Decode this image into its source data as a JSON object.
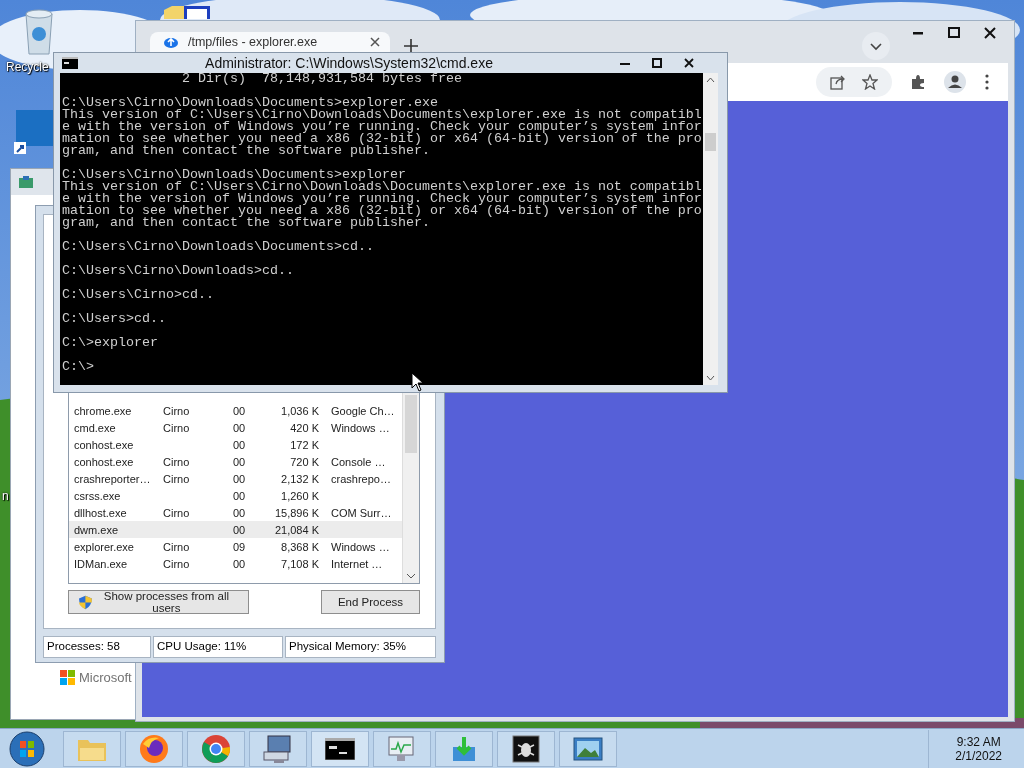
{
  "desktop": {
    "icon_labels": [
      "Recycle",
      "n"
    ]
  },
  "browser": {
    "tabs": [
      {
        "title": "/tmp/files - explorer.exe",
        "selected": true
      }
    ]
  },
  "background_window": {
    "brand": "Microsoft"
  },
  "task_manager": {
    "rows": [
      {
        "column_1": "chrome.exe",
        "column_2": "Cirno",
        "column_3": "00",
        "column_4": "1,036 K",
        "column_5": "Google Ch…",
        "selected": false
      },
      {
        "column_1": "cmd.exe",
        "column_2": "Cirno",
        "column_3": "00",
        "column_4": "420 K",
        "column_5": "Windows …",
        "selected": false
      },
      {
        "column_1": "conhost.exe",
        "column_3": "00",
        "column_4": "172 K",
        "selected": false
      },
      {
        "column_1": "conhost.exe",
        "column_2": "Cirno",
        "column_3": "00",
        "column_4": "720 K",
        "column_5": "Console …",
        "selected": false
      },
      {
        "column_1": "crashreporter…",
        "column_2": "Cirno",
        "column_3": "00",
        "column_4": "2,132 K",
        "column_5": "crashrepo…",
        "selected": false
      },
      {
        "column_1": "csrss.exe",
        "column_3": "00",
        "column_4": "1,260 K",
        "selected": false
      },
      {
        "column_1": "dllhost.exe",
        "column_2": "Cirno",
        "column_3": "00",
        "column_4": "15,896 K",
        "column_5": "COM Surr…",
        "selected": false
      },
      {
        "column_1": "dwm.exe",
        "column_3": "00",
        "column_4": "21,084 K",
        "selected": true
      },
      {
        "column_1": "explorer.exe",
        "column_2": "Cirno",
        "column_3": "09",
        "column_4": "8,368 K",
        "column_5": "Windows …",
        "selected": false
      },
      {
        "column_1": "IDMan.exe",
        "column_2": "Cirno",
        "column_3": "00",
        "column_4": "7,108 K",
        "column_5": "Internet …",
        "selected": false
      }
    ],
    "buttons": [
      "Show processes from all users",
      "End Process"
    ],
    "status_bar": [
      "Processes: 58",
      "CPU Usage: 11%",
      "Physical Memory: 35%"
    ]
  },
  "console": {
    "title": "Administrator: C:\\Windows\\System32\\cmd.exe",
    "blocks": [
      [
        "               2 Dir(s)  78,148,931,584 bytes free"
      ],
      [
        "C:\\Users\\Cirno\\Downloads\\Documents>explorer.exe",
        "This version of C:\\Users\\Cirno\\Downloads\\Documents\\explorer.exe is not compatibl",
        "e with the version of Windows you’re running. Check your computer’s system infor",
        "mation to see whether you need a x86 (32-bit) or x64 (64-bit) version of the pro",
        "gram, and then contact the software publisher."
      ],
      [
        "C:\\Users\\Cirno\\Downloads\\Documents>explorer",
        "This version of C:\\Users\\Cirno\\Downloads\\Documents\\explorer.exe is not compatibl",
        "e with the version of Windows you’re running. Check your computer’s system infor",
        "mation to see whether you need a x86 (32-bit) or x64 (64-bit) version of the pro",
        "gram, and then contact the software publisher."
      ],
      [
        "C:\\Users\\Cirno\\Downloads\\Documents>cd.."
      ],
      [
        "C:\\Users\\Cirno\\Downloads>cd.."
      ],
      [
        "C:\\Users\\Cirno>cd.."
      ],
      [
        "C:\\Users>cd.."
      ],
      [
        "C:\\>explorer"
      ],
      [
        "C:\\>"
      ]
    ]
  },
  "taskbar": {
    "clock": {
      "time": "9:32 AM",
      "date": "2/1/2022"
    }
  }
}
